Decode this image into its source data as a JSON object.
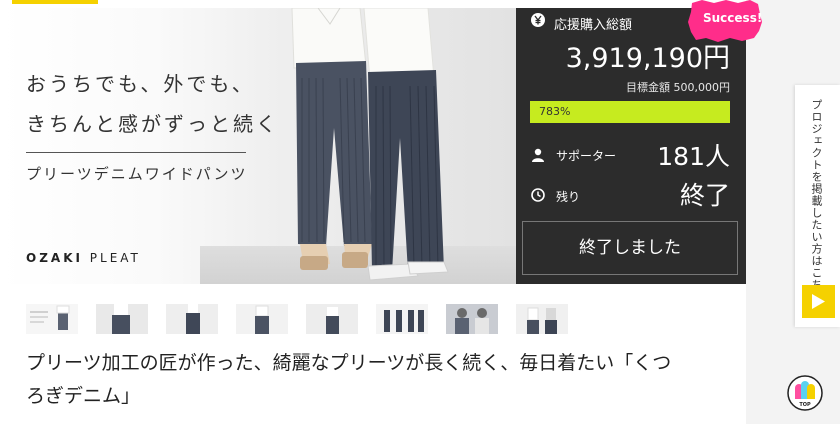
{
  "hero": {
    "tagline_line1": "おうちでも、外でも、",
    "tagline_line2": "きちんと感がずっと続く",
    "product_name": "プリーツデニムワイドパンツ",
    "brand_bold": "OZAKI",
    "brand_rest": " PLEAT"
  },
  "panel": {
    "total_label": "応援購入総額",
    "total_amount": "3,919,190円",
    "goal_text": "目標金額 500,000円",
    "progress_percent": 783,
    "progress_label": "783%",
    "supporters_label": "サポーター",
    "supporters_value": "181人",
    "remaining_label": "残り",
    "remaining_value": "終了",
    "ended_button": "終了しました",
    "badge": "Success!",
    "colors": {
      "panel_bg": "#2c2c2c",
      "progress": "#c6eb1f",
      "badge": "#ff2d8a",
      "accent": "#f5d100"
    }
  },
  "thumbnails": [
    {
      "name": "thumb-1",
      "icon": "catalog-image"
    },
    {
      "name": "thumb-2",
      "icon": "model-image"
    },
    {
      "name": "thumb-3",
      "icon": "model-image"
    },
    {
      "name": "thumb-4",
      "icon": "model-image"
    },
    {
      "name": "thumb-5",
      "icon": "model-image"
    },
    {
      "name": "thumb-6",
      "icon": "model-image"
    },
    {
      "name": "thumb-7",
      "icon": "model-image"
    },
    {
      "name": "thumb-8",
      "icon": "model-image"
    }
  ],
  "project_title": "プリーツ加工の匠が作った、綺麗なプリーツが長く続く、毎日着たい「くつろぎデニム」",
  "sidebar": {
    "post_text": "プロジェクトを掲載したい方はこちら",
    "top_label": "TOP"
  }
}
